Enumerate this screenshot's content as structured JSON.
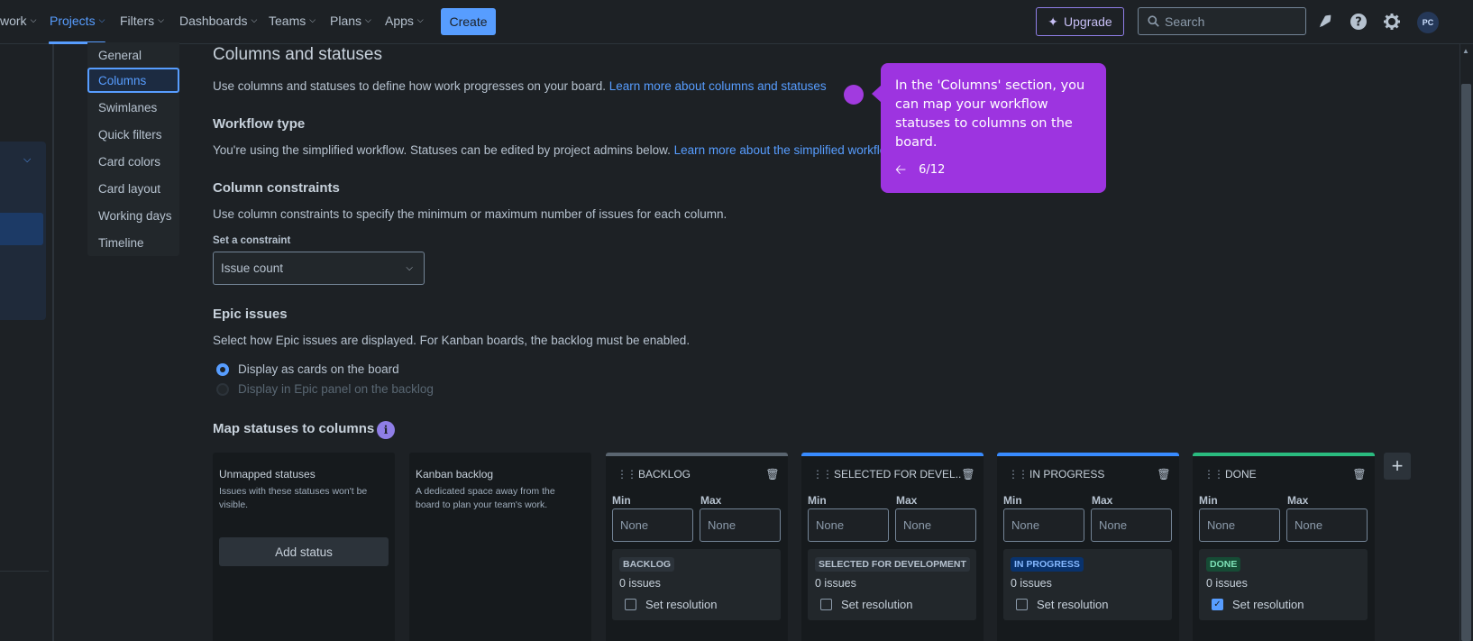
{
  "topnav": {
    "items": [
      {
        "label": "work",
        "chevron": true
      },
      {
        "label": "Projects",
        "chevron": true,
        "active": true
      },
      {
        "label": "Filters",
        "chevron": true
      },
      {
        "label": "Dashboards",
        "chevron": true
      },
      {
        "label": "Teams",
        "chevron": true
      },
      {
        "label": "Plans",
        "chevron": true
      },
      {
        "label": "Apps",
        "chevron": true
      }
    ],
    "create_label": "Create",
    "upgrade_label": "Upgrade",
    "search_placeholder": "Search",
    "avatar_initials": "PC"
  },
  "subnav": {
    "items": [
      "General",
      "Columns",
      "Swimlanes",
      "Quick filters",
      "Card colors",
      "Card layout",
      "Working days",
      "Timeline"
    ],
    "active": "Columns"
  },
  "main": {
    "title": "Columns and statuses",
    "intro": "Use columns and statuses to define how work progresses on your board.",
    "intro_link": "Learn more about columns and statuses",
    "workflow_title": "Workflow type",
    "workflow_text": "You're using the simplified workflow. Statuses can be edited by project admins below.",
    "workflow_link": "Learn more about the simplified workflow",
    "constraints_title": "Column constraints",
    "constraints_text": "Use column constraints to specify the minimum or maximum number of issues for each column.",
    "constraint_label": "Set a constraint",
    "constraint_value": "Issue count",
    "epic_title": "Epic issues",
    "epic_text": "Select how Epic issues are displayed. For Kanban boards, the backlog must be enabled.",
    "epic_option_1": "Display as cards on the board",
    "epic_option_2": "Display in Epic panel on the backlog",
    "map_title": "Map statuses to columns",
    "info_glyph": "i"
  },
  "static_columns": {
    "unmapped_title": "Unmapped statuses",
    "unmapped_desc": "Issues with these statuses won't be visible.",
    "add_status": "Add status",
    "kanban_title": "Kanban backlog",
    "kanban_desc": "A dedicated space away from the board to plan your team's work."
  },
  "columns": [
    {
      "name": "BACKLOG",
      "min_label": "Min",
      "max_label": "Max",
      "placeholder": "None",
      "status": "BACKLOG",
      "issues": "0 issues",
      "resolution": "Set resolution",
      "resolution_checked": false,
      "color": "#5a6570"
    },
    {
      "name": "SELECTED FOR DEVEL...",
      "min_label": "Min",
      "max_label": "Max",
      "placeholder": "None",
      "status": "SELECTED FOR DEVELOPMENT",
      "issues": "0 issues",
      "resolution": "Set resolution",
      "resolution_checked": false,
      "color": "#388bff"
    },
    {
      "name": "IN PROGRESS",
      "min_label": "Min",
      "max_label": "Max",
      "placeholder": "None",
      "status": "IN PROGRESS",
      "issues": "0 issues",
      "resolution": "Set resolution",
      "resolution_checked": false,
      "color": "#388bff"
    },
    {
      "name": "DONE",
      "min_label": "Min",
      "max_label": "Max",
      "placeholder": "None",
      "status": "DONE",
      "issues": "0 issues",
      "resolution": "Set resolution",
      "resolution_checked": true,
      "color": "#2abb7f"
    }
  ],
  "tooltip": {
    "text": "In the 'Columns' section, you can map your workflow statuses to columns on the board.",
    "step": "6/12"
  },
  "colors": {
    "accent": "#579dff",
    "tooltip": "#9d34e0",
    "background": "#1d2125"
  }
}
